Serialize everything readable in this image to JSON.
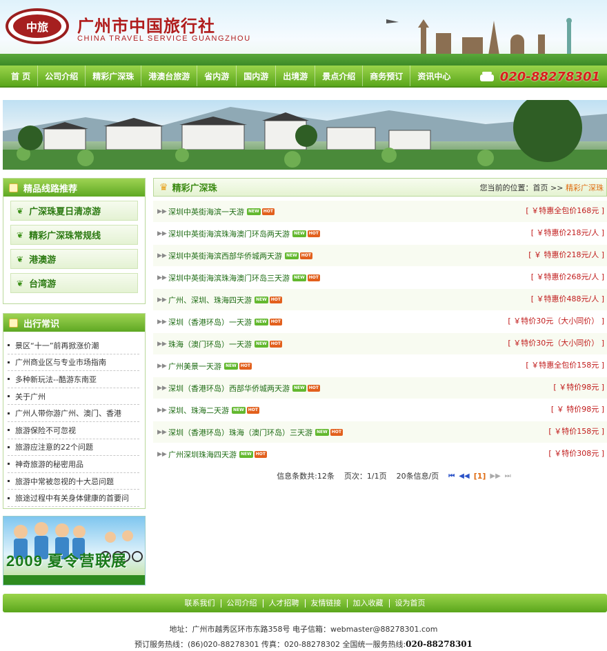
{
  "header": {
    "logo_mark": "中旅",
    "logo_cn": "广州市中国旅行社",
    "logo_en": "CHINA TRAVEL SERVICE GUANGZHOU"
  },
  "nav": {
    "items": [
      "首 页",
      "公司介绍",
      "精彩广深珠",
      "港澳台旅游",
      "省内游",
      "国内游",
      "出境游",
      "景点介绍",
      "商务预订",
      "资讯中心"
    ],
    "phone": "020-88278301"
  },
  "sidebar": {
    "routes_title": "精品线路推荐",
    "routes": [
      "广深珠夏日清凉游",
      "精彩广深珠常规线",
      "港澳游",
      "台湾游"
    ],
    "tips_title": "出行常识",
    "tips": [
      "景区“十一”前再掀涨价潮",
      "广州商业区与专业市场指南",
      "多种新玩法--酷游东南亚",
      "关于广州",
      "广州人带你游广州、澳门、香港",
      "旅游保险不可忽视",
      "旅游应注意的22个问题",
      "神奇旅游的秘密用品",
      "旅游中常被忽视的十大忌问题",
      "旅途过程中有关身体健康的首要问"
    ],
    "promo": "2009 夏令营联展"
  },
  "main": {
    "title": "精彩广深珠",
    "crumb_prefix": "您当前的位置：首页 >>",
    "crumb_current": "精彩广深珠",
    "badge_new": "NEW",
    "badge_hot": "HOT",
    "rows": [
      {
        "title": "深圳中英街海滨一天游",
        "price": "[ ￥特惠全包价168元 ]"
      },
      {
        "title": "深圳中英街海滨珠海澳门环岛两天游",
        "price": "[ ￥特惠价218元/人 ]"
      },
      {
        "title": "深圳中英街海滨西部华侨城两天游",
        "price": "[ ￥ 特惠价218元/人 ]"
      },
      {
        "title": "深圳中英街海滨珠海澳门环岛三天游",
        "price": "[ ￥特惠价268元/人 ]"
      },
      {
        "title": "广州、深圳、珠海四天游",
        "price": "[ ￥特惠价488元/人 ]"
      },
      {
        "title": "深圳（香港环岛）一天游",
        "price": "[ ￥特价30元（大小同价） ]"
      },
      {
        "title": "珠海（澳门环岛）一天游",
        "price": "[ ￥特价30元（大小同价） ]"
      },
      {
        "title": "广州美景一天游",
        "price": "[ ￥特惠全包价158元 ]"
      },
      {
        "title": "深圳（香港环岛）西部华侨城两天游",
        "price": "[ ￥特价98元 ]"
      },
      {
        "title": "深圳、珠海二天游",
        "price": "[ ￥ 特价98元 ]"
      },
      {
        "title": "深圳（香港环岛）珠海（澳门环岛）三天游",
        "price": "[ ￥特价158元 ]"
      },
      {
        "title": "广州深圳珠海四天游",
        "price": "[ ￥特价308元 ]"
      }
    ],
    "pager": {
      "total": "信息条数共:12条",
      "page": "页次：1/1页",
      "per_page": "20条信息/页",
      "current": "[1]"
    }
  },
  "footer": {
    "links": [
      "联系我们",
      "公司介绍",
      "人才招聘",
      "友情链接",
      "加入收藏",
      "设为首页"
    ],
    "address": "地址：广州市越秀区环市东路358号 电子信箱：webmaster@88278301.com",
    "hotline_prefix": "预订服务热线：(86)020-88278301 传真：020-88278302 全国统一服务热线:",
    "hotline_number": "020-88278301"
  },
  "colors": {
    "nav_green": "#5aa61c",
    "price_red": "#c01a1a",
    "title_green": "#1f6c15",
    "phone_red": "#d8201c"
  }
}
